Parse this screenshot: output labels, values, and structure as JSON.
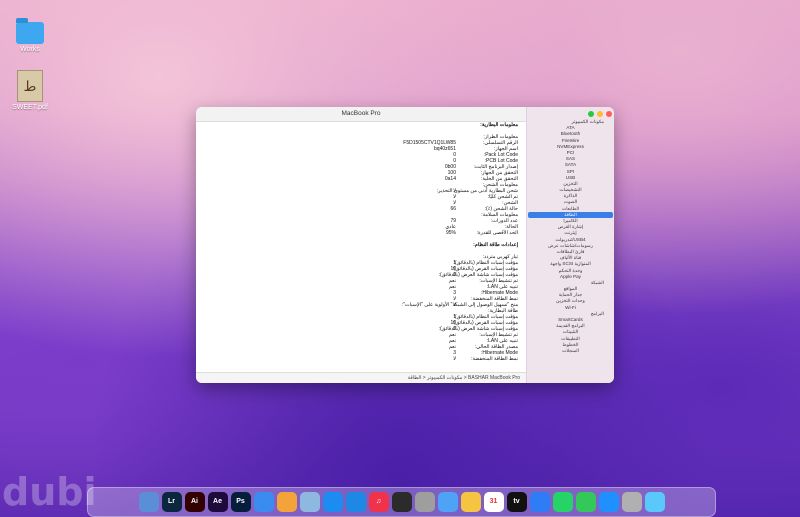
{
  "desktop": {
    "icons": [
      {
        "label": "Works"
      },
      {
        "label": "SWEET.pdf"
      }
    ],
    "watermark": "dubi"
  },
  "window": {
    "title": "MacBook Pro",
    "statusbar": "BASHAR MacBook Pro < مكونات الكمبيوتر < الطاقة",
    "sidebar": {
      "items": [
        {
          "label": "مكونات الكمبيوتر",
          "group": true
        },
        {
          "label": "ATA"
        },
        {
          "label": "Bluetooth"
        },
        {
          "label": "FireWire"
        },
        {
          "label": "NVMExpress"
        },
        {
          "label": "PCI"
        },
        {
          "label": "SAS"
        },
        {
          "label": "SATA"
        },
        {
          "label": "SPI"
        },
        {
          "label": "USB"
        },
        {
          "label": "التخزين"
        },
        {
          "label": "التشخيصات"
        },
        {
          "label": "الذاكرة"
        },
        {
          "label": "الصوت"
        },
        {
          "label": "الطابعات"
        },
        {
          "label": "الطاقة",
          "selected": true
        },
        {
          "label": "الكاميرا"
        },
        {
          "label": "إشارة القرص"
        },
        {
          "label": "إيثرنت"
        },
        {
          "label": "ثندربولت/USB4"
        },
        {
          "label": "رسومات/شاشات عرض"
        },
        {
          "label": "قارئ البطاقات"
        },
        {
          "label": "قناة الألياف"
        },
        {
          "label": "واجهة SCSI المتوازية"
        },
        {
          "label": "وحدة التحكم"
        },
        {
          "label": "Apple Pay"
        },
        {
          "label": "الشبكة",
          "group": true
        },
        {
          "label": "المواقع"
        },
        {
          "label": "جدار الحماية"
        },
        {
          "label": "وحدات التخزين"
        },
        {
          "label": "Wi-Fi"
        },
        {
          "label": "البرامج",
          "group": true
        },
        {
          "label": "SmartCards"
        },
        {
          "label": "البرامج القديمة"
        },
        {
          "label": "التثبيتات"
        },
        {
          "label": "التطبيقات"
        },
        {
          "label": "الخطوط"
        },
        {
          "label": "السجلات"
        }
      ]
    },
    "content": {
      "rows": [
        {
          "k": "معلومات البطارية:",
          "v": "",
          "h": true
        },
        {
          "k": "",
          "v": ""
        },
        {
          "k": "معلومات الطراز:",
          "v": ""
        },
        {
          "k": "الرقم التسلسلي:",
          "v": "F5D1505CTV1Q1LW85"
        },
        {
          "k": "اسم الجهاز:",
          "v": "bq40z651"
        },
        {
          "k": "Pack Lot Code:",
          "v": "0"
        },
        {
          "k": "PCB Lot Code:",
          "v": "0"
        },
        {
          "k": "إصدار البرنامج الثابت:",
          "v": "0b00"
        },
        {
          "k": "التحقق من الجهاز:",
          "v": "100"
        },
        {
          "k": "التحقق من الخلية:",
          "v": "0a14"
        },
        {
          "k": "معلومات الشحن:",
          "v": ""
        },
        {
          "k": "شحن البطارية أدنى من مستوى التحذير:",
          "v": "لا"
        },
        {
          "k": "تم الشحن كليًا:",
          "v": "لا"
        },
        {
          "k": "الشحن:",
          "v": "لا"
        },
        {
          "k": "حالة الشحن (٪):",
          "v": "66"
        },
        {
          "k": "معلومات السلامة:",
          "v": ""
        },
        {
          "k": "عدد الدورات:",
          "v": "79"
        },
        {
          "k": "الحالة:",
          "v": "عادي"
        },
        {
          "k": "الحد الأقصى للقدرة:",
          "v": "95%"
        },
        {
          "k": "",
          "v": ""
        },
        {
          "k": "إعدادات طاقة النظام:",
          "v": "",
          "h": true
        },
        {
          "k": "",
          "v": ""
        },
        {
          "k": "تيار كهربي متردد:",
          "v": ""
        },
        {
          "k": "مؤقت إسبات النظام (بالدقائق):",
          "v": "1"
        },
        {
          "k": "مؤقت إسبات القرص (بالدقائق):",
          "v": "10"
        },
        {
          "k": "مؤقت إسبات شاشة العرض (بالدقائق):",
          "v": "0"
        },
        {
          "k": "تم تنشيط الإسبات:",
          "v": "نعم"
        },
        {
          "k": "تنبيه على LAN:",
          "v": "نعم"
        },
        {
          "k": "Hibernate Mode:",
          "v": "3"
        },
        {
          "k": "نمط الطاقة المنخفضة:",
          "v": "لا"
        },
        {
          "k": "منح \"تسهيل الوصول إلى الشبكة\" الأولوية على \"الإسبات\":",
          "v": "لا"
        },
        {
          "k": "طاقة البطارية:",
          "v": ""
        },
        {
          "k": "مؤقت إسبات النظام (بالدقائق):",
          "v": "1"
        },
        {
          "k": "مؤقت إسبات القرص (بالدقائق):",
          "v": "10"
        },
        {
          "k": "مؤقت إسبات شاشة العرض (بالدقائق):",
          "v": "0"
        },
        {
          "k": "تم تنشيط الإسبات:",
          "v": "نعم"
        },
        {
          "k": "تنبيه على LAN:",
          "v": "نعم"
        },
        {
          "k": "مصدر الطاقة الحالي:",
          "v": "نعم"
        },
        {
          "k": "Hibernate Mode:",
          "v": "3"
        },
        {
          "k": "نمط الطاقة المنخفضة:",
          "v": "لا"
        }
      ]
    }
  },
  "dock": {
    "apps": [
      {
        "name": "",
        "color": "#5a8fd8"
      },
      {
        "name": "Lr",
        "color": "#0b2740"
      },
      {
        "name": "Ai",
        "color": "#330000"
      },
      {
        "name": "Ae",
        "color": "#1f0a3c"
      },
      {
        "name": "Ps",
        "color": "#061e3c"
      },
      {
        "name": "",
        "color": "#3b8cf0"
      },
      {
        "name": "",
        "color": "#f2a33a"
      },
      {
        "name": "",
        "color": "#8fb8e0"
      },
      {
        "name": "",
        "color": "#1d8cf0"
      },
      {
        "name": "",
        "color": "#1e88e5"
      },
      {
        "name": "♫",
        "color": "#f0334a"
      },
      {
        "name": "",
        "color": "#2b2b2b"
      },
      {
        "name": "",
        "color": "#9e9e9e"
      },
      {
        "name": "",
        "color": "#4fa3f7"
      },
      {
        "name": "",
        "color": "#f5c542"
      },
      {
        "name": "31",
        "color": "#ffffff"
      },
      {
        "name": "tv",
        "color": "#111111"
      },
      {
        "name": "",
        "color": "#2f7df6"
      },
      {
        "name": "",
        "color": "#25d366"
      },
      {
        "name": "",
        "color": "#34c759"
      },
      {
        "name": "",
        "color": "#1e90ff"
      },
      {
        "name": "",
        "color": "#b0b0b0"
      },
      {
        "name": "",
        "color": "#5ac8fa"
      }
    ]
  }
}
